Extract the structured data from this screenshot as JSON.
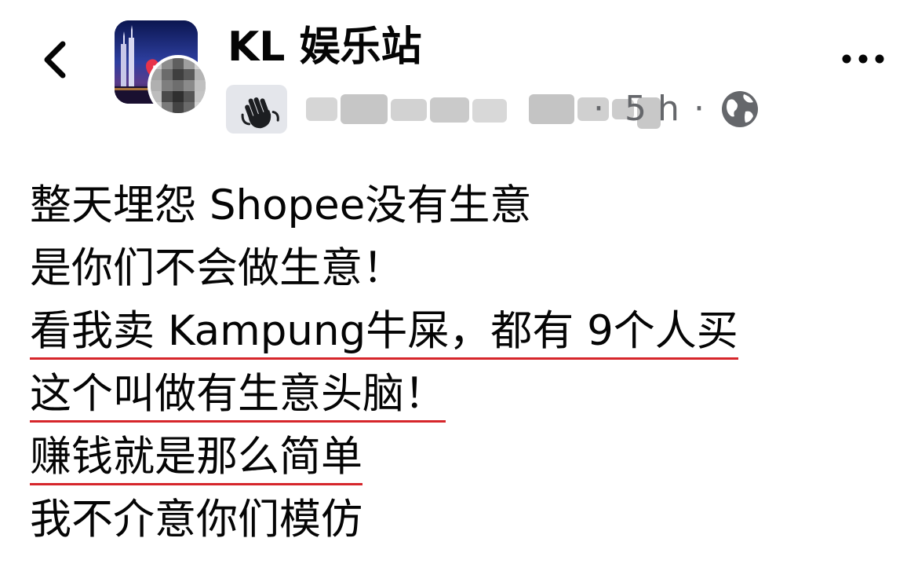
{
  "header": {
    "title": "KL 娱乐站",
    "timestamp": "5 h",
    "separator": "·",
    "privacy_icon": "globe-icon",
    "back_icon": "chevron-left-icon",
    "more_icon": "more-dots-icon",
    "badge_icon": "waving-hand-icon"
  },
  "post": {
    "lines": [
      {
        "text": "整天埋怨 Shopee没有生意",
        "underlined": false
      },
      {
        "text": "是你们不会做生意！",
        "underlined": false
      },
      {
        "text": "看我卖 Kampung牛屎，都有 9个人买",
        "underlined": true
      },
      {
        "text": "这个叫做有生意头脑！",
        "underlined": true
      },
      {
        "text": "赚钱就是那么简单",
        "underlined": true
      },
      {
        "text": "我不介意你们模仿",
        "underlined": false
      }
    ]
  },
  "colors": {
    "text": "#050505",
    "secondary_text": "#65676b",
    "underline": "#d6262b",
    "badge_bg": "#e4e6eb"
  }
}
